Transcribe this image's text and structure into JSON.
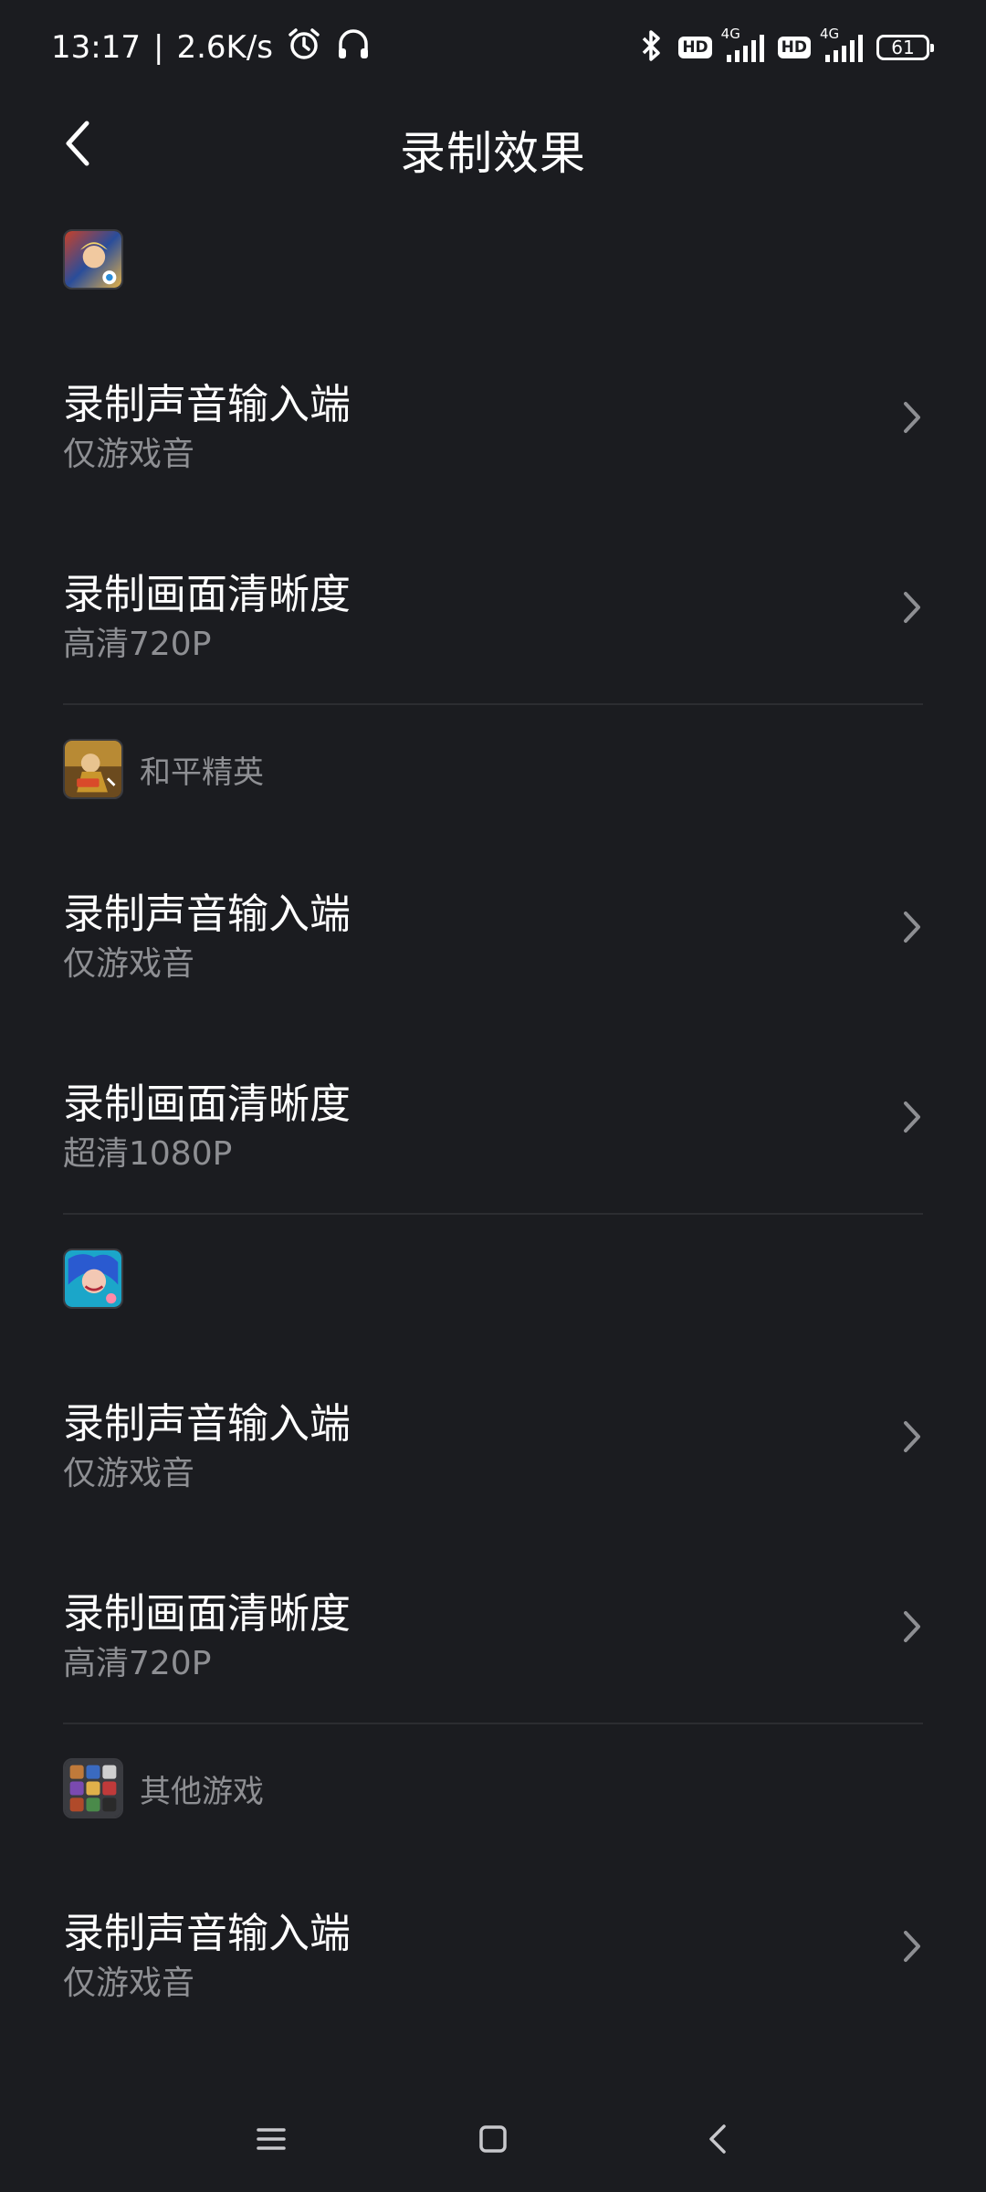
{
  "status_bar": {
    "time": "13:17",
    "separator": "|",
    "net_speed": "2.6K/s",
    "hd_label": "HD",
    "network_label": "4G",
    "battery": "61"
  },
  "header": {
    "title": "录制效果"
  },
  "sections": [
    {
      "game_name": "",
      "icon": "game-icon-hero",
      "rows": [
        {
          "title": "录制声音输入端",
          "value": "仅游戏音"
        },
        {
          "title": "录制画面清晰度",
          "value": "高清720P"
        }
      ]
    },
    {
      "game_name": "和平精英",
      "icon": "game-icon-peace-elite",
      "rows": [
        {
          "title": "录制声音输入端",
          "value": "仅游戏音"
        },
        {
          "title": "录制画面清晰度",
          "value": "超清1080P"
        }
      ]
    },
    {
      "game_name": "",
      "icon": "game-icon-blue-hair",
      "rows": [
        {
          "title": "录制声音输入端",
          "value": "仅游戏音"
        },
        {
          "title": "录制画面清晰度",
          "value": "高清720P"
        }
      ]
    },
    {
      "game_name": "其他游戏",
      "icon": "game-icon-other-games",
      "rows": [
        {
          "title": "录制声音输入端",
          "value": "仅游戏音"
        }
      ]
    }
  ],
  "colors": {
    "background": "#1b1c20",
    "primary_text": "#ffffff",
    "secondary_text": "#8e8f93",
    "divider": "#2c2d31"
  }
}
